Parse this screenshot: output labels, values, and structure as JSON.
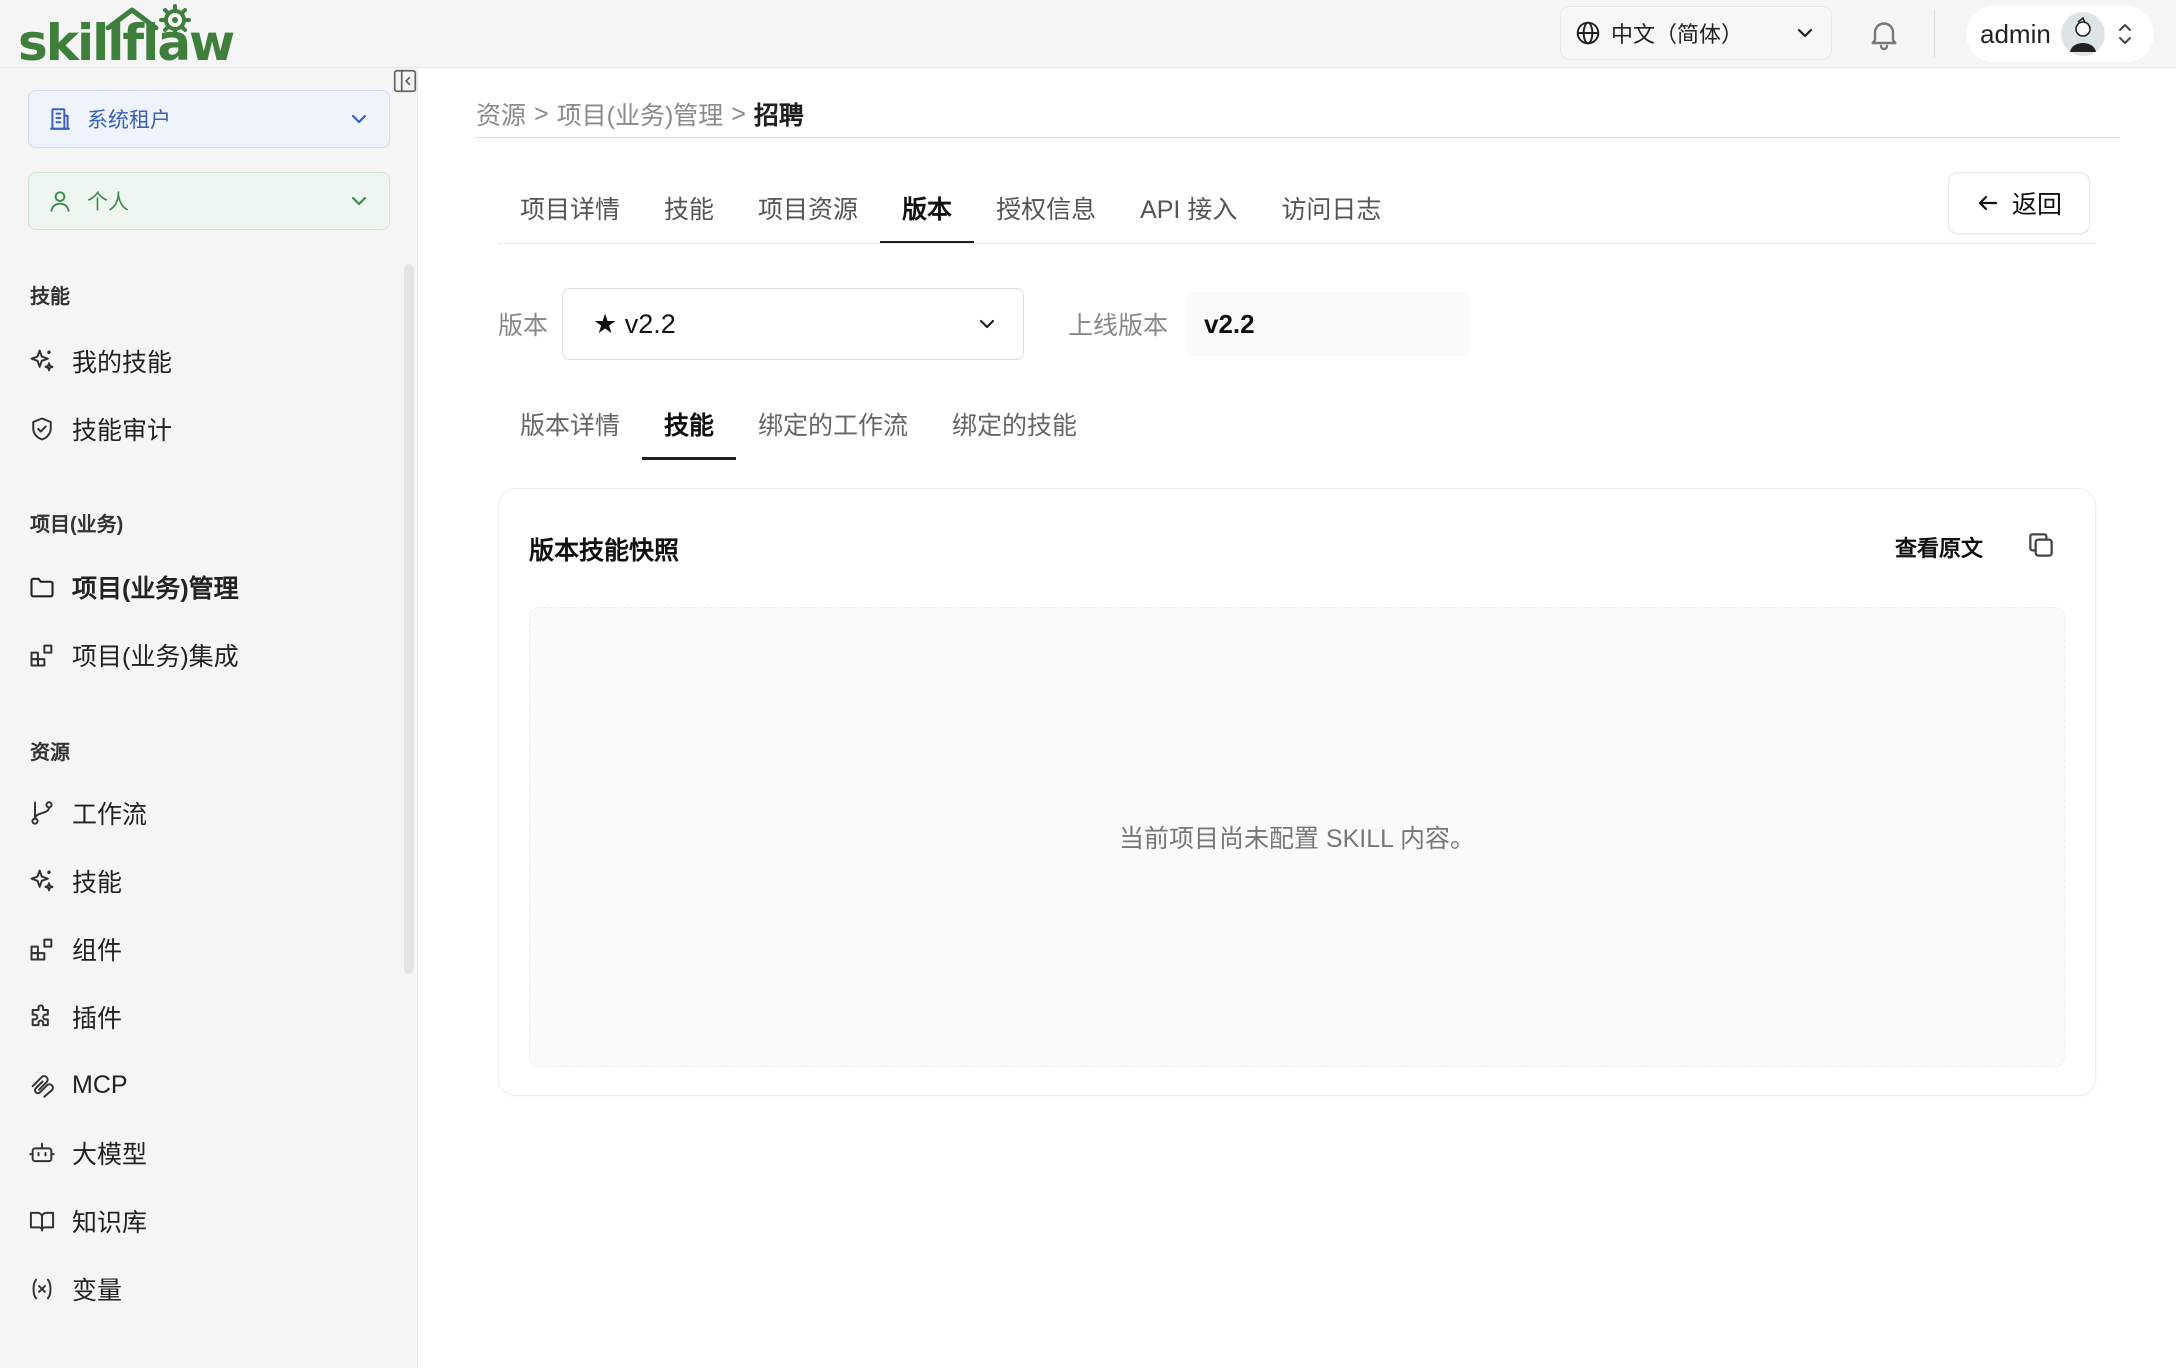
{
  "brand": {
    "logo_text": "skillflaw"
  },
  "header": {
    "language": "中文（简体）",
    "user_name": "admin"
  },
  "sidebar": {
    "tenant_select": "系统租户",
    "space_select": "个人",
    "sections": [
      {
        "title": "技能",
        "items": [
          {
            "label": "我的技能",
            "icon": "sparkle-icon"
          },
          {
            "label": "技能审计",
            "icon": "shield-check-icon"
          }
        ]
      },
      {
        "title": "项目(业务)",
        "items": [
          {
            "label": "项目(业务)管理",
            "icon": "folder-icon",
            "active": true
          },
          {
            "label": "项目(业务)集成",
            "icon": "blocks-icon"
          }
        ]
      },
      {
        "title": "资源",
        "items": [
          {
            "label": "工作流",
            "icon": "git-branch-icon"
          },
          {
            "label": "技能",
            "icon": "sparkle-icon"
          },
          {
            "label": "组件",
            "icon": "blocks-icon"
          },
          {
            "label": "插件",
            "icon": "puzzle-icon"
          },
          {
            "label": "MCP",
            "icon": "mcp-icon"
          },
          {
            "label": "大模型",
            "icon": "bot-icon"
          },
          {
            "label": "知识库",
            "icon": "book-icon"
          },
          {
            "label": "变量",
            "icon": "variable-icon"
          }
        ]
      }
    ]
  },
  "breadcrumb": {
    "items": [
      "资源",
      "项目(业务)管理"
    ],
    "separator": ">",
    "current": "招聘"
  },
  "main_tabs": [
    {
      "label": "项目详情"
    },
    {
      "label": "技能"
    },
    {
      "label": "项目资源"
    },
    {
      "label": "版本",
      "active": true
    },
    {
      "label": "授权信息"
    },
    {
      "label": "API 接入"
    },
    {
      "label": "访问日志"
    }
  ],
  "back_button": "返回",
  "version": {
    "label": "版本",
    "selected": "★ v2.2",
    "online_label": "上线版本",
    "online_value": "v2.2"
  },
  "sub_tabs": [
    {
      "label": "版本详情"
    },
    {
      "label": "技能",
      "active": true
    },
    {
      "label": "绑定的工作流"
    },
    {
      "label": "绑定的技能"
    }
  ],
  "snapshot_card": {
    "title": "版本技能快照",
    "view_raw": "查看原文",
    "empty_message": "当前项目尚未配置 SKILL 内容。"
  }
}
